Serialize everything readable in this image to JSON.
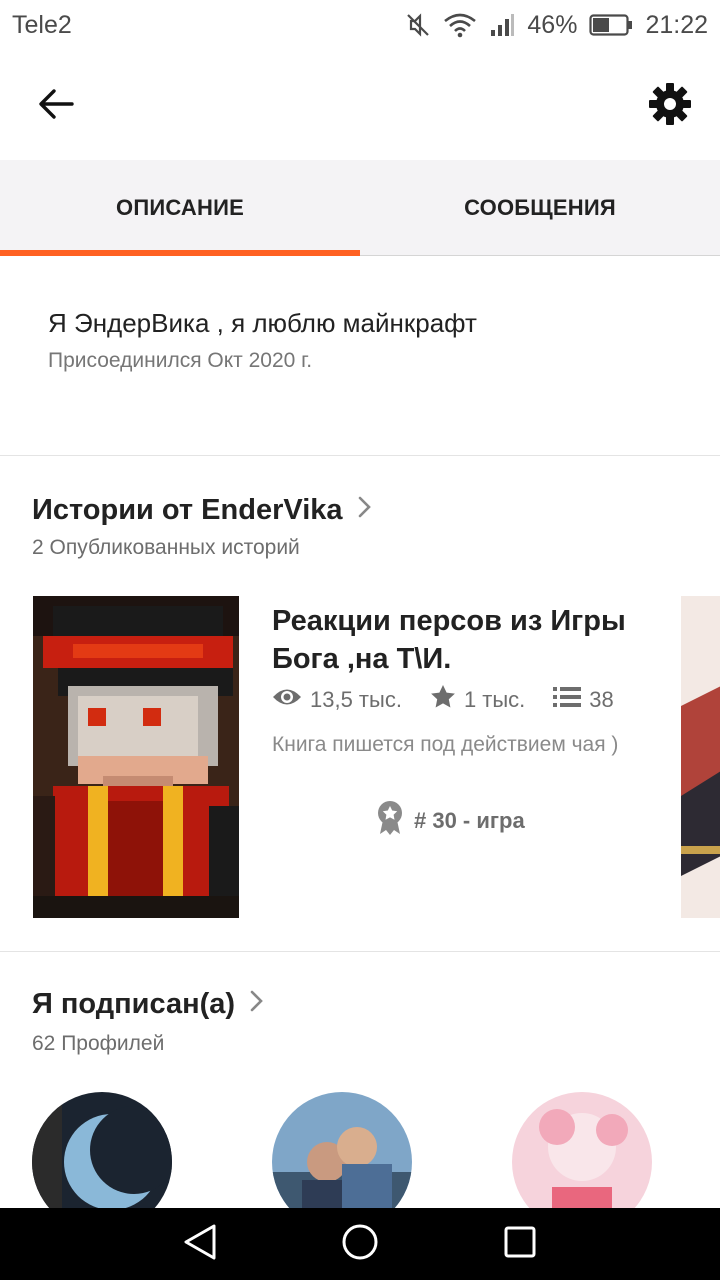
{
  "status_bar": {
    "carrier": "Tele2",
    "battery": "46%",
    "time": "21:22"
  },
  "tabs": [
    {
      "label": "ОПИСАНИЕ",
      "active": true
    },
    {
      "label": "СООБЩЕНИЯ",
      "active": false
    }
  ],
  "about": {
    "text": "Я ЭндерВика , я люблю майнкрафт",
    "joined": "Присоединился Окт 2020 г."
  },
  "stories": {
    "title": "Истории от EnderVika",
    "subtitle": "2 Опубликованных историй",
    "items": [
      {
        "title": "Реакции персов  из Игры Бога ,на Т\\И.",
        "views": "13,5 тыс.",
        "votes": "1 тыс.",
        "parts": "38",
        "description": "Книга пишется под действием чая )",
        "rank": "# 30 - игра"
      }
    ]
  },
  "following": {
    "title": "Я подписан(а)",
    "subtitle": "62 Профилей"
  },
  "colors": {
    "accent": "#ff6122",
    "tab_bg": "#f4f3f5"
  },
  "icons": [
    "mute-icon",
    "wifi-icon",
    "signal-icon",
    "battery-icon",
    "back-arrow-icon",
    "gear-icon",
    "chevron-right-icon",
    "eye-icon",
    "star-icon",
    "list-icon",
    "award-icon",
    "nav-back-icon",
    "nav-home-icon",
    "nav-recents-icon"
  ]
}
